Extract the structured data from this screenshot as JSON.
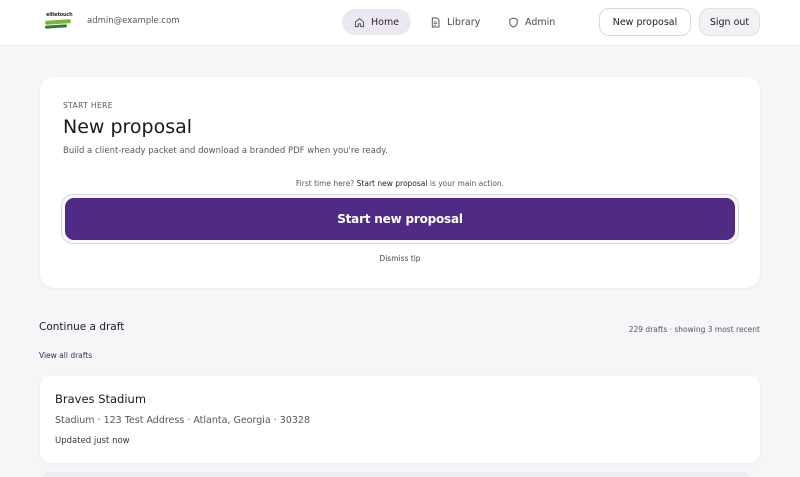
{
  "header": {
    "user_email": "admin@example.com",
    "logo_text": "elitetouch",
    "nav": {
      "home": "Home",
      "library": "Library",
      "admin": "Admin"
    },
    "new_proposal_label": "New proposal",
    "sign_out_label": "Sign out"
  },
  "hero": {
    "eyebrow": "START HERE",
    "title": "New proposal",
    "subtitle": "Build a client-ready packet and download a branded PDF when you're ready.",
    "tip_prefix": "First time here? ",
    "tip_bold": "Start new proposal",
    "tip_suffix": " is your main action.",
    "cta_label": "Start new proposal",
    "dismiss_label": "Dismiss tip"
  },
  "drafts": {
    "title": "Continue a draft",
    "count_text": "229 drafts · showing 3 most recent",
    "view_all_label": "View all drafts",
    "items": [
      {
        "name": "Braves Stadium",
        "meta": "Stadium · 123 Test Address · Atlanta, Georgia · 30328",
        "updated": "Updated just now"
      }
    ]
  },
  "colors": {
    "accent": "#4f2b86",
    "page_bg": "#f7f5f8",
    "nav_active_bg": "#ece8f1"
  },
  "icons": {
    "home": "home-icon",
    "library": "document-icon",
    "admin": "shield-icon"
  }
}
